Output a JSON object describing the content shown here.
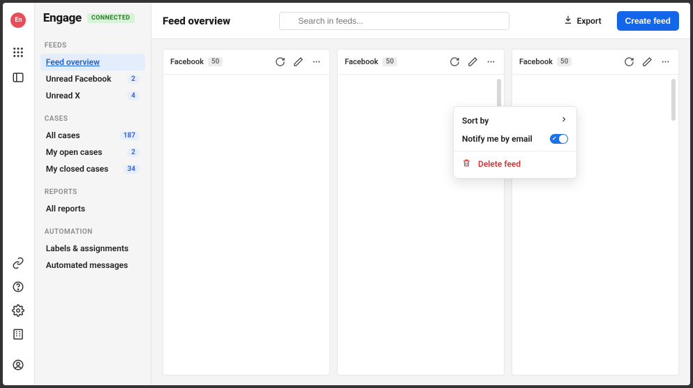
{
  "brand": {
    "logo_text": "En",
    "name": "Engage",
    "status": "CONNECTED"
  },
  "sidebar": {
    "groups": {
      "feeds": {
        "label": "FEEDS",
        "items": [
          {
            "label": "Feed overview",
            "badge": ""
          },
          {
            "label": "Unread Facebook",
            "badge": "2"
          },
          {
            "label": "Unread X",
            "badge": "4"
          }
        ]
      },
      "cases": {
        "label": "CASES",
        "items": [
          {
            "label": "All cases",
            "badge": "187"
          },
          {
            "label": "My open cases",
            "badge": "2"
          },
          {
            "label": "My closed cases",
            "badge": "34"
          }
        ]
      },
      "reports": {
        "label": "REPORTS",
        "items": [
          {
            "label": "All reports",
            "badge": ""
          }
        ]
      },
      "automation": {
        "label": "AUTOMATION",
        "items": [
          {
            "label": "Labels & assignments",
            "badge": ""
          },
          {
            "label": "Automated messages",
            "badge": ""
          }
        ]
      }
    }
  },
  "topbar": {
    "title": "Feed overview",
    "search_placeholder": "Search in feeds...",
    "export_label": "Export",
    "create_label": "Create feed"
  },
  "columns": [
    {
      "title": "Facebook",
      "count": "50"
    },
    {
      "title": "Facebook",
      "count": "50"
    },
    {
      "title": "Facebook",
      "count": "50"
    }
  ],
  "popover": {
    "sort_label": "Sort by",
    "notify_label": "Notify me by email",
    "notify_on": true,
    "delete_label": "Delete feed"
  }
}
